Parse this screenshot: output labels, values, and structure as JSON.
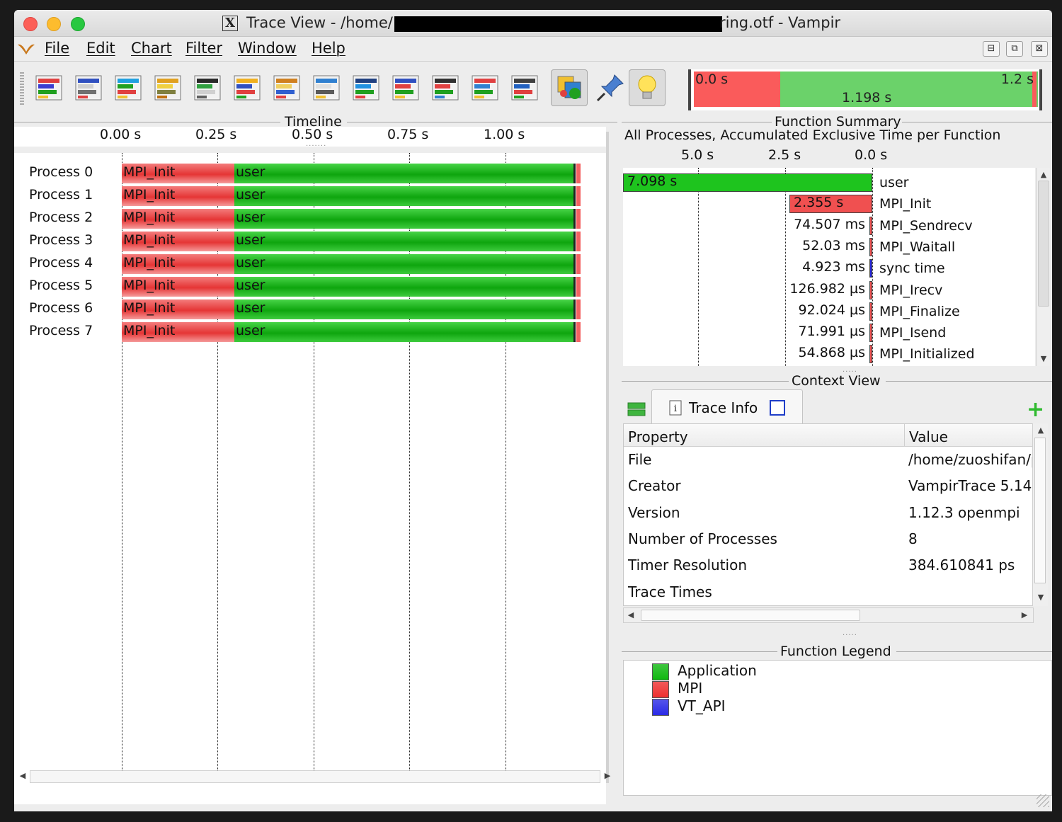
{
  "window": {
    "title_prefix": "Trace View - /home/",
    "title_suffix": "ring.otf  - Vampir",
    "x_glyph": "X"
  },
  "menu": [
    "File",
    "Edit",
    "Chart",
    "Filter",
    "Window",
    "Help"
  ],
  "mdi_controls": [
    "⊟",
    "⧉",
    "⊠"
  ],
  "toolbar": {
    "icons": [
      "master-timeline-icon",
      "process-timeline-icon",
      "summary-timeline-icon",
      "counter-data-timeline-icon",
      "performance-radar-icon",
      "function-summary-icon",
      "process-summary-icon",
      "message-summary-icon",
      "communication-matrix-icon",
      "io-summary-icon",
      "call-tree-icon",
      "function-legend-icon",
      "marker-view-icon",
      "context-view-icon",
      "comparison-view-icon",
      "filter-icon",
      "pin-icon",
      "hint-bulb-icon"
    ]
  },
  "overview": {
    "start": "0.0 s",
    "end": "1.2 s",
    "duration": "1.198 s",
    "mpi_fraction": 0.25
  },
  "timeline": {
    "title": "Timeline",
    "ticks": [
      "0.00 s",
      "0.25 s",
      "0.50 s",
      "0.75 s",
      "1.00 s"
    ],
    "processes": [
      {
        "label": "Process 0",
        "mpi": "MPI_Init",
        "user": "user"
      },
      {
        "label": "Process 1",
        "mpi": "MPI_Init",
        "user": "user"
      },
      {
        "label": "Process 2",
        "mpi": "MPI_Init",
        "user": "user"
      },
      {
        "label": "Process 3",
        "mpi": "MPI_Init",
        "user": "user"
      },
      {
        "label": "Process 4",
        "mpi": "MPI_Init",
        "user": "user"
      },
      {
        "label": "Process 5",
        "mpi": "MPI_Init",
        "user": "user"
      },
      {
        "label": "Process 6",
        "mpi": "MPI_Init",
        "user": "user"
      },
      {
        "label": "Process 7",
        "mpi": "MPI_Init",
        "user": "user"
      }
    ]
  },
  "function_summary": {
    "title": "Function Summary",
    "heading": "All Processes, Accumulated Exclusive Time per Function",
    "ticks": [
      "5.0 s",
      "2.5 s",
      "0.0 s"
    ],
    "rows": [
      {
        "value": "7.098 s",
        "name": "user",
        "color": "#1ec41e",
        "seconds": 7.098
      },
      {
        "value": "2.355 s",
        "name": "MPI_Init",
        "color": "#f05050",
        "seconds": 2.355
      },
      {
        "value": "74.507 ms",
        "name": "MPI_Sendrecv",
        "color": "#f05050",
        "seconds": 0.074507
      },
      {
        "value": "52.03 ms",
        "name": "MPI_Waitall",
        "color": "#f05050",
        "seconds": 0.05203
      },
      {
        "value": "4.923 ms",
        "name": "sync time",
        "color": "#2424e0",
        "seconds": 0.004923
      },
      {
        "value": "126.982 µs",
        "name": "MPI_Irecv",
        "color": "#f05050",
        "seconds": 0.000126982
      },
      {
        "value": "92.024 µs",
        "name": "MPI_Finalize",
        "color": "#f05050",
        "seconds": 9.2024e-05
      },
      {
        "value": "71.991 µs",
        "name": "MPI_Isend",
        "color": "#f05050",
        "seconds": 7.1991e-05
      },
      {
        "value": "54.868 µs",
        "name": "MPI_Initialized",
        "color": "#f05050",
        "seconds": 5.4868e-05
      }
    ]
  },
  "context_view": {
    "title": "Context View",
    "tab": "Trace Info",
    "columns": [
      "Property",
      "Value"
    ],
    "rows": [
      {
        "property": "File",
        "value": "/home/zuoshifan/p"
      },
      {
        "property": "Creator",
        "value": "VampirTrace 5.14"
      },
      {
        "property": "Version",
        "value": "1.12.3 openmpi"
      },
      {
        "property": "Number of Processes",
        "value": "8"
      },
      {
        "property": "Timer Resolution",
        "value": "384.610841 ps"
      },
      {
        "property": "Trace Times",
        "value": ""
      }
    ]
  },
  "function_legend": {
    "title": "Function Legend",
    "items": [
      {
        "label": "Application",
        "color": "#10b810"
      },
      {
        "label": "MPI",
        "color": "#ee3030"
      },
      {
        "label": "VT_API",
        "color": "#2a2ae6"
      }
    ]
  }
}
